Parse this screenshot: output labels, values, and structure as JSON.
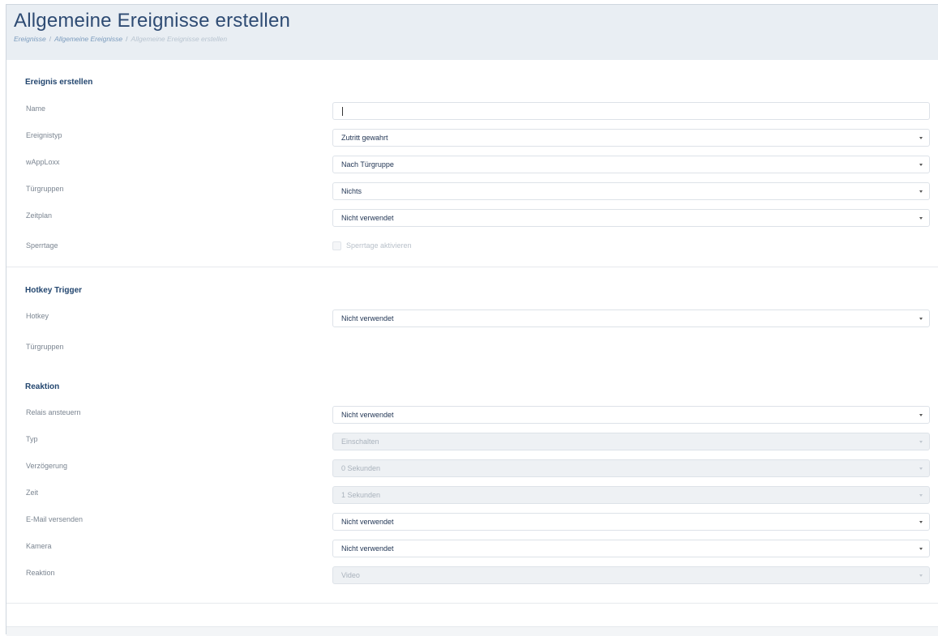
{
  "page": {
    "title": "Allgemeine Ereignisse erstellen",
    "breadcrumb": [
      "Ereignisse",
      "Allgemeine Ereignisse",
      "Allgemeine Ereignisse erstellen"
    ],
    "breadcrumb_separator": "/"
  },
  "event_section": {
    "title": "Ereignis erstellen",
    "name": {
      "label": "Name",
      "value": ""
    },
    "event_type": {
      "label": "Ereignistyp",
      "value": "Zutritt gewahrt"
    },
    "wapploxx": {
      "label": "wAppLoxx",
      "value": "Nach Türgruppe"
    },
    "door_groups": {
      "label": "Türgruppen",
      "value": "Nichts"
    },
    "schedule": {
      "label": "Zeitplan",
      "value": "Nicht verwendet"
    },
    "blocking_days": {
      "label": "Sperrtage",
      "checkbox_label": "Sperrtage aktivieren",
      "checked": false,
      "enabled": false
    }
  },
  "hotkey_section": {
    "title": "Hotkey Trigger",
    "hotkey": {
      "label": "Hotkey",
      "value": "Nicht verwendet"
    },
    "door_groups": {
      "label": "Türgruppen"
    }
  },
  "reaction_section": {
    "title": "Reaktion",
    "relay": {
      "label": "Relais ansteuern",
      "value": "Nicht verwendet"
    },
    "type": {
      "label": "Typ",
      "value": "Einschalten",
      "enabled": false
    },
    "delay": {
      "label": "Verzögerung",
      "value": "0 Sekunden",
      "enabled": false
    },
    "time": {
      "label": "Zeit",
      "value": "1 Sekunden",
      "enabled": false
    },
    "email": {
      "label": "E-Mail versenden",
      "value": "Nicht verwendet"
    },
    "camera": {
      "label": "Kamera",
      "value": "Nicht verwendet"
    },
    "reaction": {
      "label": "Reaktion",
      "value": "Video",
      "enabled": false
    }
  },
  "colors": {
    "accent": "#23466f",
    "header_bg": "#e9eef3",
    "disabled_bg": "#eef1f4"
  },
  "icons": {
    "dropdown": "chevron-down-icon"
  }
}
